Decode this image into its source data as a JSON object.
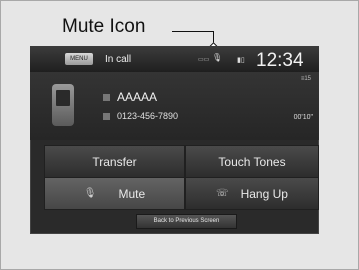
{
  "callout": {
    "label": "Mute Icon"
  },
  "status_bar": {
    "menu_label": "MENU",
    "title": "In call",
    "time": "12:34",
    "right_small": "≡15"
  },
  "call_info": {
    "name": "AAAAA",
    "number": "0123-456-7890",
    "duration": "00'10\""
  },
  "buttons": {
    "transfer": "Transfer",
    "touch_tones": "Touch Tones",
    "mute": "Mute",
    "hang_up": "Hang Up",
    "back": "Back to Previous Screen"
  },
  "icons": {
    "mute": "microphone-icon",
    "hang_up": "phone-hangup-icon",
    "battery": "battery-icon",
    "phone": "phone-icon"
  }
}
